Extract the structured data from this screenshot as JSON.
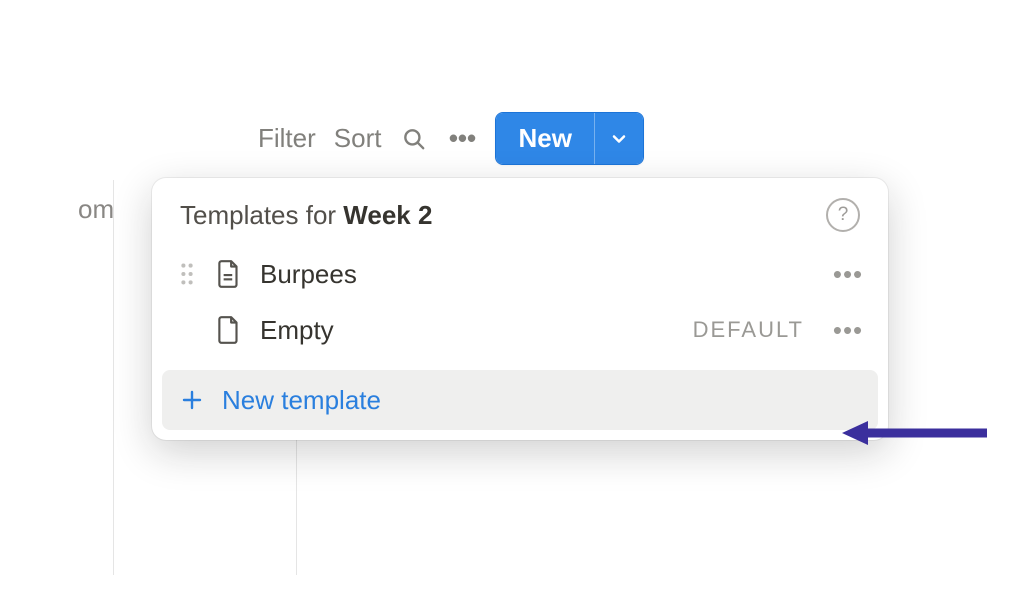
{
  "toolbar": {
    "filter_label": "Filter",
    "sort_label": "Sort",
    "new_label": "New"
  },
  "left_peek": "om",
  "popover": {
    "title_prefix": "Templates for ",
    "title_emph": "Week 2",
    "items": [
      {
        "name": "Burpees",
        "show_drag": true,
        "show_default": false
      },
      {
        "name": "Empty",
        "show_drag": false,
        "show_default": true,
        "default_label": "DEFAULT"
      }
    ],
    "footer_label": "New template"
  }
}
